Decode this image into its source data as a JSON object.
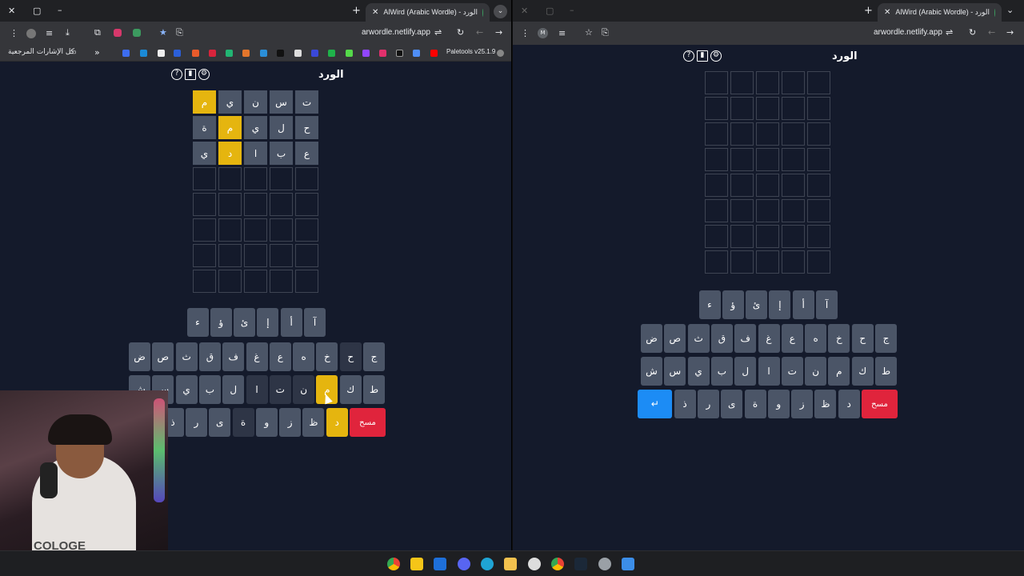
{
  "left": {
    "tab_title": "AlWird (Arabic Wordle) - الورد",
    "url": "arwordle.netlify.app",
    "bookmarks_folder": "كل الإشارات المرجعية",
    "ext_label": "Paletools v25.1.9",
    "app_title": "الورد",
    "grid": [
      [
        "ت",
        "س",
        "ن",
        "ي",
        "م"
      ],
      [
        "ح",
        "ل",
        "ي",
        "م",
        "ة"
      ],
      [
        "ع",
        "ب",
        "ا",
        "د",
        "ي"
      ],
      [
        "",
        "",
        "",
        "",
        ""
      ],
      [
        "",
        "",
        "",
        "",
        ""
      ],
      [
        "",
        "",
        "",
        "",
        ""
      ],
      [
        "",
        "",
        "",
        "",
        ""
      ],
      [
        "",
        "",
        "",
        "",
        ""
      ]
    ],
    "grid_states": [
      [
        "filled",
        "filled",
        "filled",
        "filled",
        "present"
      ],
      [
        "filled",
        "filled",
        "filled",
        "present",
        "filled"
      ],
      [
        "filled",
        "filled",
        "filled",
        "present",
        "filled"
      ]
    ],
    "kb_row1": [
      "آ",
      "أ",
      "إ",
      "ئ",
      "ؤ",
      "ء"
    ],
    "kb_row2": [
      "ج",
      "ح",
      "خ",
      "ه",
      "ع",
      "غ",
      "ف",
      "ق",
      "ث",
      "ص",
      "ض"
    ],
    "kb_row3": [
      "ط",
      "ك",
      "م",
      "ن",
      "ت",
      "ا",
      "ل",
      "ب",
      "ي",
      "س",
      "ش"
    ],
    "kb_row4": [
      "مسح",
      "د",
      "ظ",
      "ز",
      "و",
      "ة",
      "ى",
      "ر",
      "ذ"
    ],
    "kb_row2_states": [
      "filled",
      "dark",
      "filled",
      "filled",
      "filled",
      "filled",
      "filled",
      "filled",
      "filled",
      "filled",
      "filled"
    ],
    "kb_row3_states": [
      "filled",
      "filled",
      "present",
      "dark",
      "dark",
      "dark",
      "filled",
      "filled",
      "filled",
      "filled",
      "filled"
    ],
    "kb_row4_states": [
      "del",
      "present",
      "filled",
      "filled",
      "filled",
      "dark",
      "filled",
      "filled",
      "filled"
    ]
  },
  "right": {
    "tab_title": "AlWird (Arabic Wordle) - الورد",
    "url": "arwordle.netlify.app",
    "app_title": "الورد",
    "kb_row1": [
      "آ",
      "أ",
      "إ",
      "ئ",
      "ؤ",
      "ء"
    ],
    "kb_row2": [
      "ج",
      "ح",
      "خ",
      "ه",
      "ع",
      "غ",
      "ف",
      "ق",
      "ث",
      "ص",
      "ض"
    ],
    "kb_row3": [
      "ط",
      "ك",
      "م",
      "ن",
      "ت",
      "ا",
      "ل",
      "ب",
      "ي",
      "س",
      "ش"
    ],
    "kb_row4": [
      "مسح",
      "د",
      "ظ",
      "ز",
      "و",
      "ة",
      "ى",
      "ر",
      "ذ",
      "↵"
    ]
  },
  "webcam_text": "COLOGE",
  "colors": {
    "present": "#e5b50f",
    "delete": "#e0243c",
    "enter": "#1c8cf5",
    "tile": "#4b5567",
    "bg": "#141a2b"
  }
}
